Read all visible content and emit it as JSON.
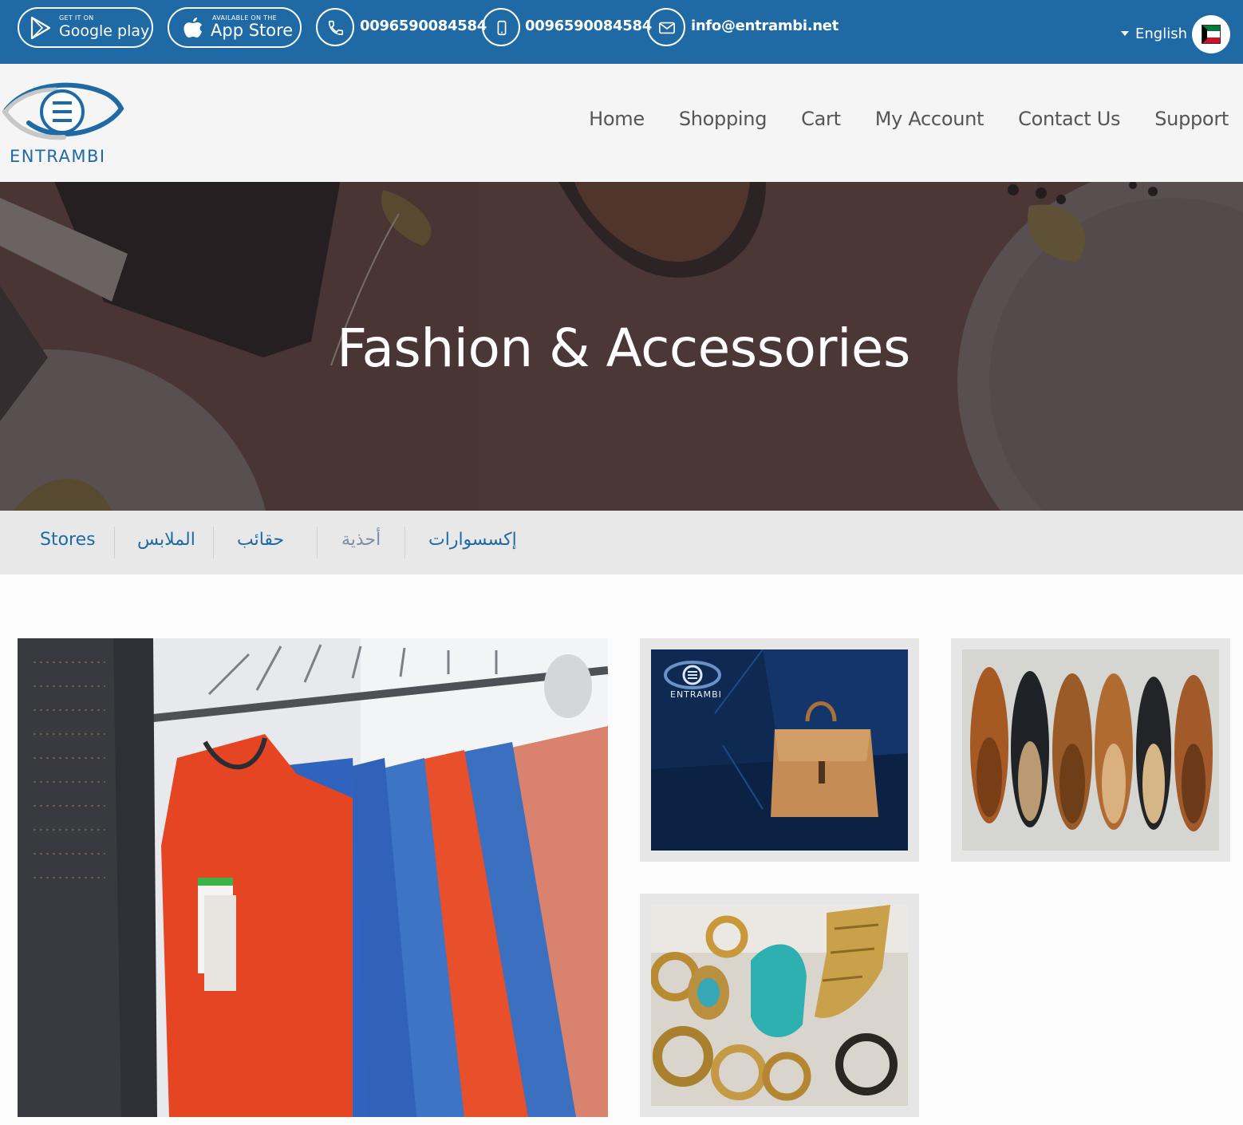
{
  "topbar": {
    "google_play": {
      "small": "GET IT ON",
      "big": "Google play"
    },
    "app_store": {
      "small": "AVAILABLE ON THE",
      "big": "App Store"
    },
    "phone": "0096590084584",
    "mobile": "0096590084584",
    "email": "info@entrambi.net",
    "language": "English",
    "flag": "kuwait-flag",
    "color": "#1f6aa5"
  },
  "header": {
    "logo_text": "ENTRAMBI",
    "nav": [
      "Home",
      "Shopping",
      "Cart",
      "My Account",
      "Contact Us",
      "Support"
    ]
  },
  "hero": {
    "title": "Fashion & Accessories"
  },
  "categories": [
    "Stores",
    "الملابس",
    "حقائب",
    "أحذية",
    "إكسسوارات"
  ],
  "tiles": {
    "bag_logo_text": "ENTRAMBI"
  }
}
